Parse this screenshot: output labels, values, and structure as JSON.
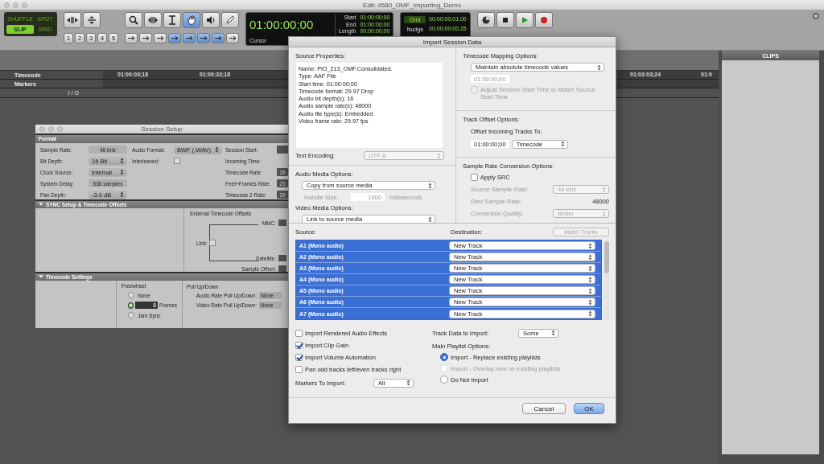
{
  "window": {
    "title": "Edit: 4580_OMF_Importing_Demo"
  },
  "toolbar": {
    "edit_modes": [
      {
        "label": "SHUFFLE",
        "selected": false
      },
      {
        "label": "SPOT",
        "selected": false
      },
      {
        "label": "SLIP",
        "selected": true
      },
      {
        "label": "GRID",
        "selected": false
      }
    ],
    "zoom_presets": [
      "1",
      "2",
      "3",
      "4",
      "5"
    ],
    "main_counter": {
      "value": "01:00:00;00",
      "label": "Cursor"
    },
    "selection": [
      {
        "label": "Start",
        "value": "01:00:00;00"
      },
      {
        "label": "End",
        "value": "01:00:00;00"
      },
      {
        "label": "Length",
        "value": "00:00:00;00"
      }
    ],
    "grid": {
      "label": "Grid",
      "value": "00:00:00:01.00"
    },
    "nudge": {
      "label": "Nudge",
      "value": "00:00:00:00.25"
    }
  },
  "rulers": [
    {
      "label": "Timecode"
    },
    {
      "label": "Markers"
    }
  ],
  "timecode_ticks": [
    "01:00:03;18",
    "01:00:33;18",
    "01:03:03;24",
    "01:0"
  ],
  "track": {
    "io_label": "I / O"
  },
  "clips_panel": {
    "title": "CLIPS"
  },
  "session_setup": {
    "title": "Session Setup",
    "format": {
      "heading": "Format",
      "column_1": [
        {
          "label": "Sample Rate:",
          "value": "48 kHz",
          "kind": "display"
        },
        {
          "label": "Bit Depth:",
          "value": "16 Bit",
          "kind": "popup"
        },
        {
          "label": "Clock Source:",
          "value": "Internal",
          "kind": "popup"
        },
        {
          "label": "System Delay:",
          "value": "538 samples",
          "kind": "display"
        },
        {
          "label": "Pan Depth:",
          "value": "-3.0 dB",
          "kind": "popup"
        }
      ],
      "column_2": [
        {
          "label": "Audio Format:",
          "value": "BWF (.WAV)",
          "kind": "popup"
        },
        {
          "label": "Interleaved:",
          "kind": "checkbox",
          "checked": false
        }
      ],
      "column_3": [
        {
          "label": "Session Start:",
          "kind": "field"
        },
        {
          "label": "Incoming Time:",
          "kind": "blank"
        },
        {
          "label": "Timecode Rate:",
          "value": "29",
          "kind": "field"
        },
        {
          "label": "Feet+Frames Rate:",
          "value": "23",
          "kind": "field"
        },
        {
          "label": "Timecode 2 Rate:",
          "value": "29",
          "kind": "field"
        }
      ]
    },
    "sync": {
      "heading": "SYNC Setup & Timecode Offsets",
      "expanded": true,
      "offsets_title": "External Timecode Offsets",
      "mmc_label": "MMC:",
      "link_label": "Link:",
      "link_checked": false,
      "satellite_label": "Satellite:",
      "sample_offset_label": "Sample Offset:"
    },
    "timecode_settings": {
      "heading": "Timecode Settings",
      "expanded": true,
      "freewheel_title": "Freewheel",
      "freewheel_options": [
        {
          "label": "None",
          "selected": false
        },
        {
          "label": "Frames",
          "selected": true,
          "value": "8"
        },
        {
          "label": "Jam Sync",
          "selected": false
        }
      ],
      "pull_title": "Pull Up/Down",
      "pulls": [
        {
          "label": "Audio Rate Pull Up/Down:",
          "value": "None"
        },
        {
          "label": "Video Rate Pull Up/Down:",
          "value": "None"
        }
      ]
    }
  },
  "import_dialog": {
    "title": "Import Session Data",
    "source_properties": {
      "heading": "Source Properties:",
      "lines": [
        "Name: PIO_213_OMF.Consolidated.",
        "Type: AAF File",
        "Start time: 01:00:00;00",
        "Timecode format: 29.97 Drop",
        "Audio bit depth(s): 16",
        "Audio sample rate(s): 48000",
        "Audio file type(s): Embedded",
        "Video frame rate: 29.97 fps"
      ]
    },
    "text_encoding": {
      "label": "Text Encoding:",
      "value": "UTF-8",
      "disabled": true
    },
    "audio_media": {
      "heading": "Audio Media Options:",
      "value": "Copy from source media",
      "handle_label": "Handle Size:",
      "handle_value": "1000",
      "handle_unit": "milliseconds",
      "handle_disabled": true
    },
    "video_media": {
      "heading": "Video Media Options:",
      "value": "Link to source media"
    },
    "timecode_mapping": {
      "heading": "Timecode Mapping Options:",
      "value": "Maintain absolute timecode values",
      "time": "01:00:00;00",
      "time_disabled": true,
      "adjust_label": "Adjust Session Start Time to Match Source Start Time",
      "adjust_checked": false,
      "adjust_disabled": true
    },
    "track_offset": {
      "heading": "Track Offset Options:",
      "label": "Offset Incoming Tracks To:",
      "time": "01:00:00;00",
      "unit": "Timecode"
    },
    "sample_rate_conversion": {
      "heading": "Sample Rate Conversion Options:",
      "apply_label": "Apply SRC",
      "apply_checked": false,
      "disabled": true,
      "rows": [
        {
          "label": "Source Sample Rate:",
          "value": "48 kHz",
          "kind": "popup"
        },
        {
          "label": "Dest Sample Rate:",
          "value": "48000",
          "kind": "text"
        },
        {
          "label": "Conversion Quality:",
          "value": "Better",
          "kind": "popup"
        }
      ]
    },
    "tracks": {
      "source_heading": "Source:",
      "destination_heading": "Destination:",
      "match_button": {
        "label": "Match Tracks",
        "disabled": true
      },
      "rows": [
        {
          "source": "A1 (Mono audio)",
          "destination": "New Track",
          "selected": true
        },
        {
          "source": "A2 (Mono audio)",
          "destination": "New Track",
          "selected": true
        },
        {
          "source": "A3 (Mono audio)",
          "destination": "New Track",
          "selected": true
        },
        {
          "source": "A4 (Mono audio)",
          "destination": "New Track",
          "selected": true
        },
        {
          "source": "A5 (Mono audio)",
          "destination": "New Track",
          "selected": true
        },
        {
          "source": "A6 (Mono audio)",
          "destination": "New Track",
          "selected": true
        },
        {
          "source": "A7 (Mono audio)",
          "destination": "New Track",
          "selected": true
        }
      ]
    },
    "import_options": [
      {
        "label": "Import Rendered Audio Effects",
        "checked": false
      },
      {
        "label": "Import Clip Gain",
        "checked": true
      },
      {
        "label": "Import Volume Automation",
        "checked": true
      },
      {
        "label": "Pan odd tracks left/even tracks right",
        "checked": false
      }
    ],
    "markers": {
      "label": "Markers To Import:",
      "value": "All"
    },
    "track_data": {
      "label": "Track Data to Import:",
      "value": "Some"
    },
    "playlist": {
      "heading": "Main Playlist Options:",
      "options": [
        {
          "label": "Import - Replace existing playlists",
          "selected": true,
          "disabled": false
        },
        {
          "label": "Import - Overlay new on existing playlists",
          "selected": false,
          "disabled": true
        },
        {
          "label": "Do Not Import",
          "selected": false,
          "disabled": false
        }
      ]
    },
    "buttons": [
      {
        "label": "Cancel",
        "default": false
      },
      {
        "label": "OK",
        "default": true
      }
    ]
  }
}
